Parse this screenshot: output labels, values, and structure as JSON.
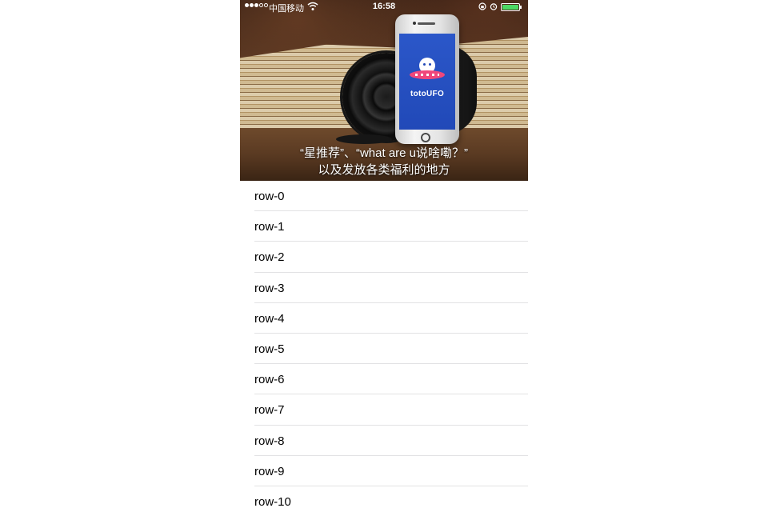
{
  "status_bar": {
    "carrier": "中国移动",
    "time": "16:58",
    "signal_bars_filled": 3,
    "signal_bars_total": 5,
    "battery_level": 1.0
  },
  "banner": {
    "app_name": "totoUFO",
    "caption_line_1": "“星推荐”、“what are u说啥嘞？”",
    "caption_line_2": "以及发放各类福利的地方",
    "screen_color": "#2149b8",
    "saucer_color": "#f0477b"
  },
  "rows": [
    "row-0",
    "row-1",
    "row-2",
    "row-3",
    "row-4",
    "row-5",
    "row-6",
    "row-7",
    "row-8",
    "row-9",
    "row-10"
  ]
}
